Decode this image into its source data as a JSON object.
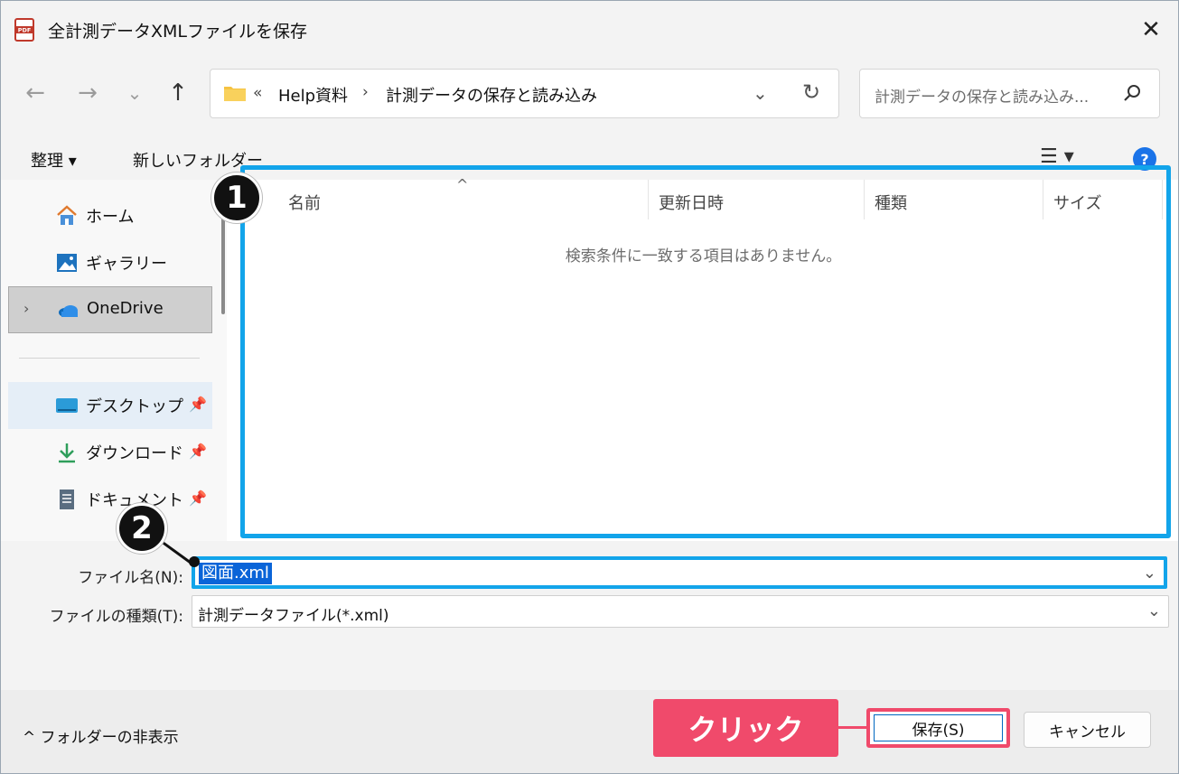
{
  "window": {
    "title": "全計測データXMLファイルを保存",
    "close": "✕"
  },
  "nav": {
    "back": "←",
    "forward": "→",
    "recent": "⌄",
    "up": "↑"
  },
  "address": {
    "overflow": "«",
    "segment1": "Help資料",
    "separator": "›",
    "segment2": "計測データの保存と読み込み",
    "dropdown": "⌄",
    "refresh": "↻"
  },
  "search": {
    "placeholder": "計測データの保存と読み込み..."
  },
  "toolbar": {
    "organize": "整理 ▾",
    "new_folder": "新しいフォルダー",
    "view": "☰ ▾",
    "help": "?"
  },
  "sidebar": {
    "items": [
      {
        "label": "ホーム"
      },
      {
        "label": "ギャラリー"
      },
      {
        "label": "OneDrive",
        "expander": "›"
      },
      {
        "label": "デスクトップ",
        "pin": "📌"
      },
      {
        "label": "ダウンロード",
        "pin": "📌"
      },
      {
        "label": "ドキュメント",
        "pin": "📌"
      }
    ]
  },
  "filelist": {
    "columns": [
      "名前",
      "更新日時",
      "種類",
      "サイズ"
    ],
    "sort_indicator": "^",
    "empty_message": "検索条件に一致する項目はありません。"
  },
  "annotations": {
    "badge1": "1",
    "badge2": "2",
    "click": "クリック",
    "accent": "#12a4ea",
    "click_color": "#f04a6b"
  },
  "form": {
    "filename_label": "ファイル名(N):",
    "filename_value": "図面.xml",
    "filetype_label": "ファイルの種類(T):",
    "filetype_value": "計測データファイル(*.xml)",
    "dropdown": "⌄"
  },
  "footer": {
    "hide_folders": "^ フォルダーの非表示",
    "save": "保存(S)",
    "cancel": "キャンセル"
  }
}
